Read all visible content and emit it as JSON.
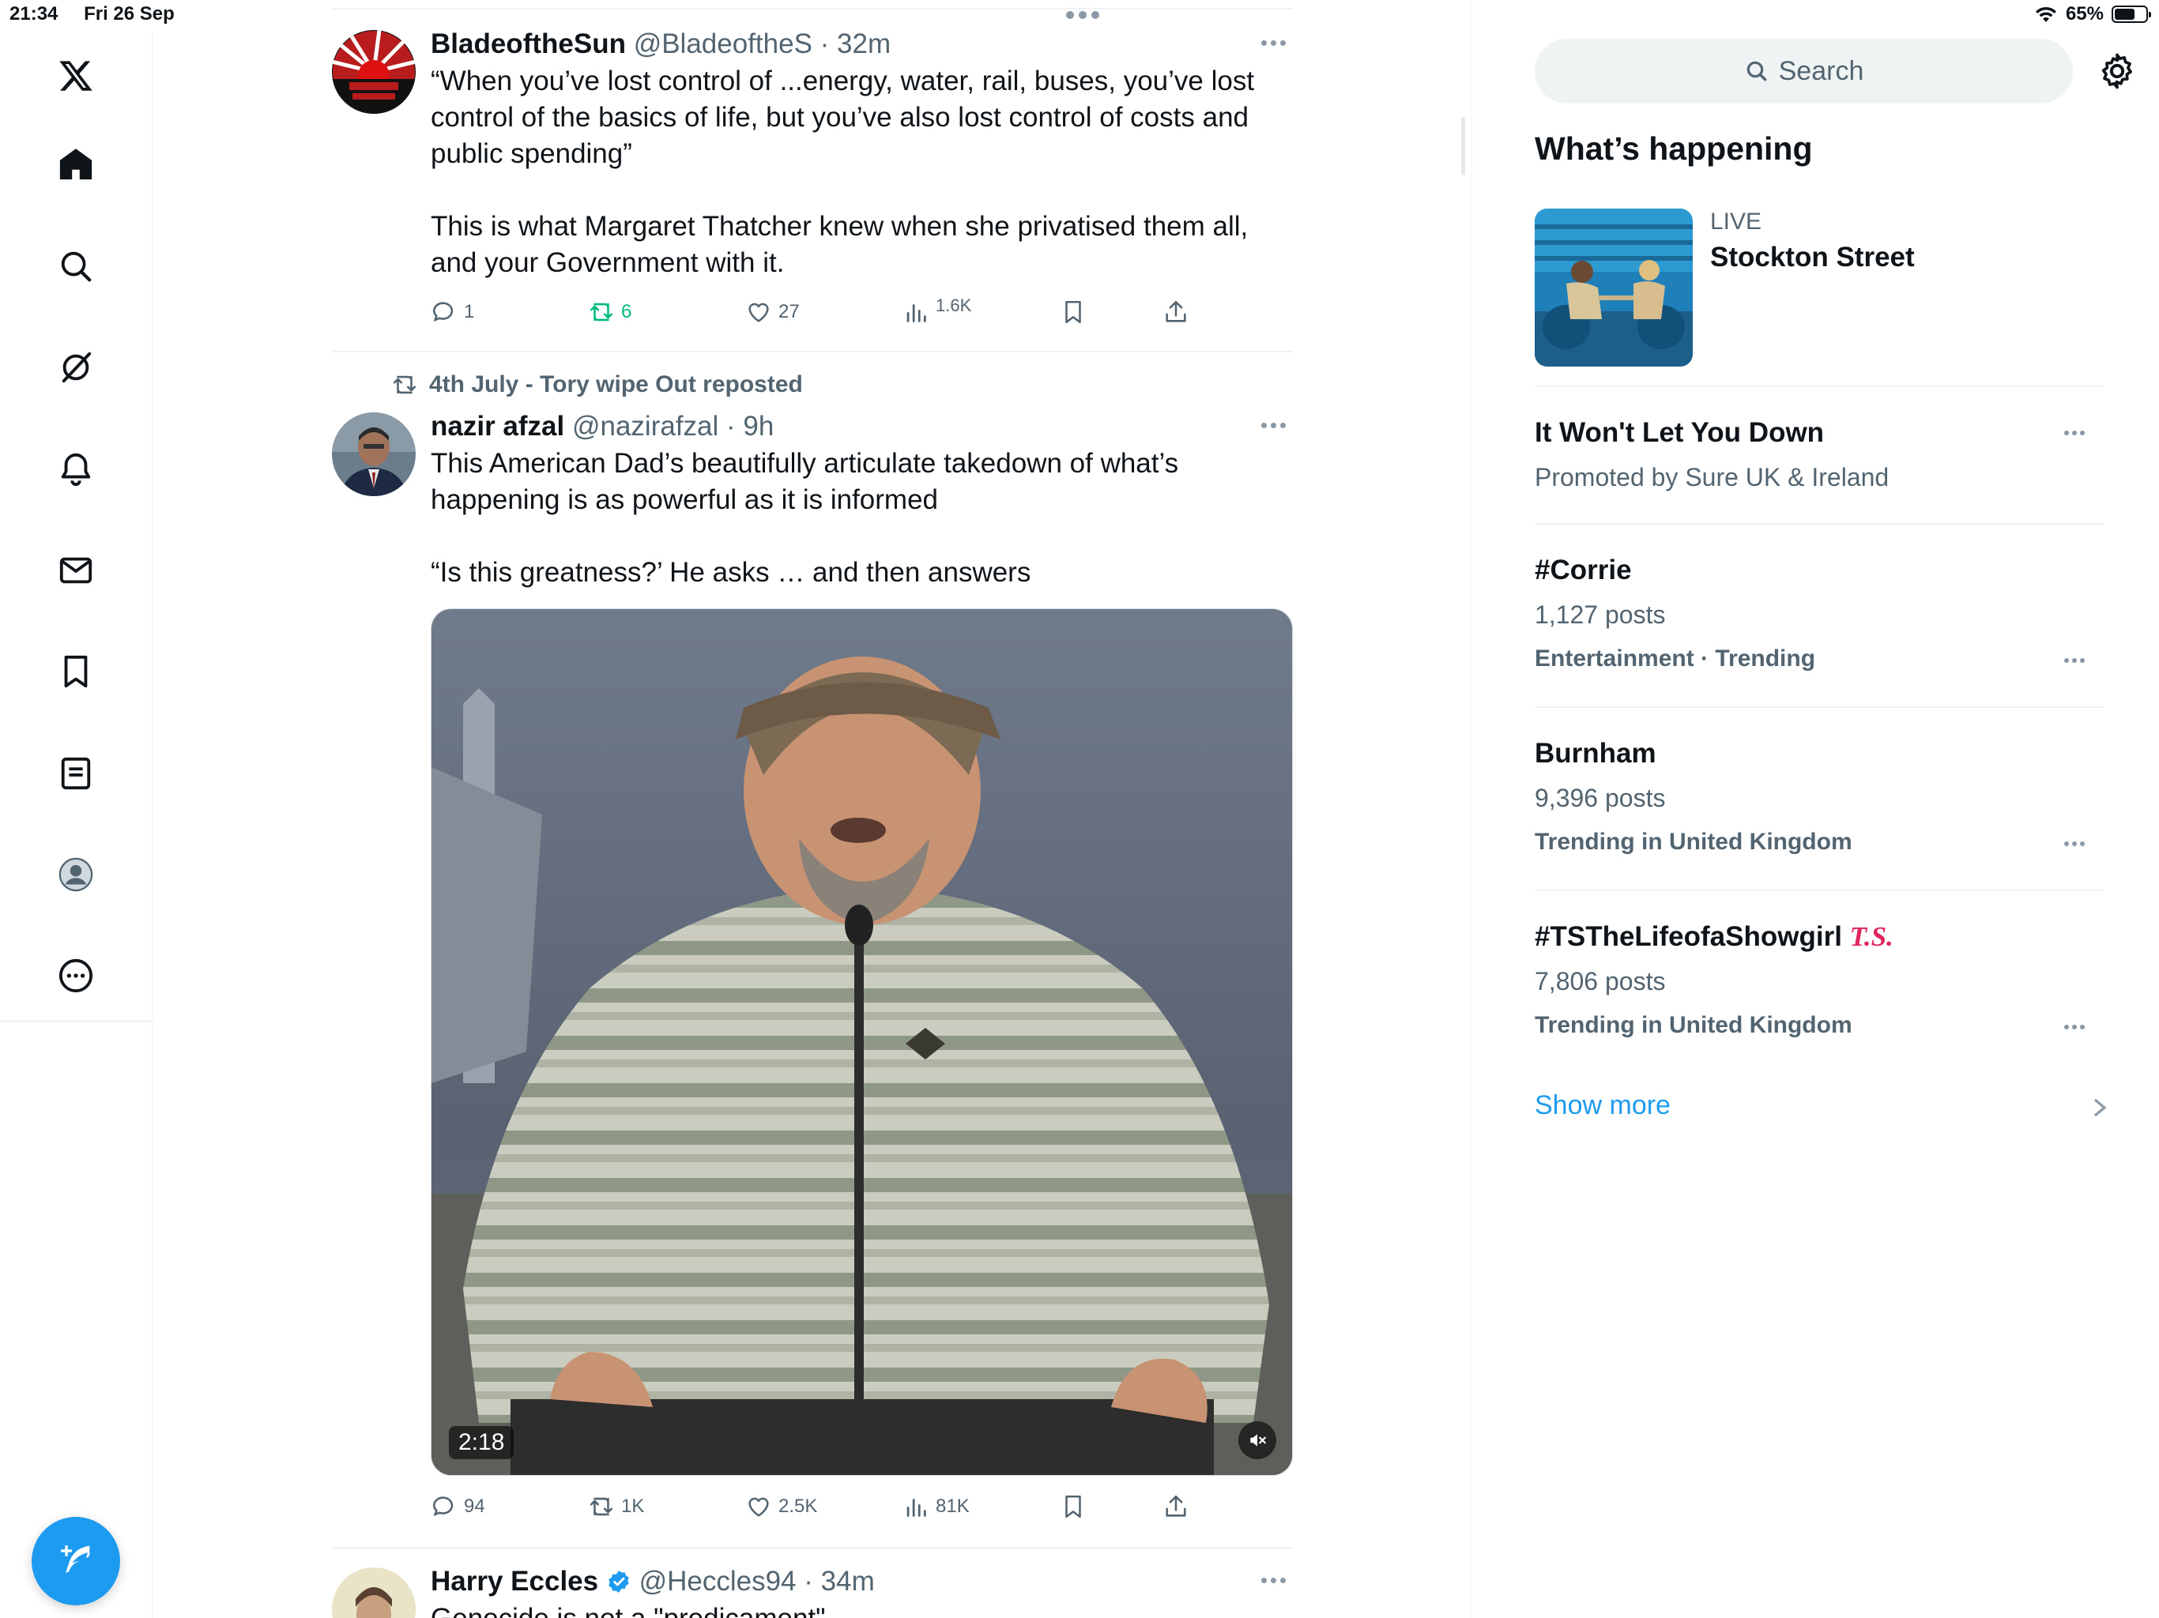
{
  "status_bar": {
    "time": "21:34",
    "date": "Fri 26 Sep",
    "battery": "65%",
    "battery_level": 0.65
  },
  "nav": {
    "items": [
      "x-logo",
      "home",
      "explore",
      "grok",
      "notifications",
      "messages",
      "bookmarks",
      "lists",
      "profile",
      "more"
    ]
  },
  "tweets": [
    {
      "name": "BladeoftheSun",
      "handle": "@BladeoftheS",
      "time": "32m",
      "text": [
        "“When you’ve lost control of ...energy, water, rail, buses, you’ve lost control of the basics of life, but you’ve also lost control of costs and public spending”",
        "This is what Margaret Thatcher knew when she privatised them all, and your Government with it."
      ],
      "replies": "1",
      "reposts": "6",
      "likes": "27",
      "views": "1.6K"
    },
    {
      "reposted_by": "4th July - Tory wipe Out reposted",
      "name": "nazir afzal",
      "handle": "@nazirafzal",
      "time": "9h",
      "text": [
        "This American Dad’s beautifully articulate takedown of what’s happening is as powerful as it is informed",
        "“Is this greatness?’ He asks … and then answers"
      ],
      "video_duration": "2:18",
      "replies": "94",
      "reposts": "1K",
      "likes": "2.5K",
      "views": "81K"
    },
    {
      "name": "Harry Eccles",
      "handle": "@Heccles94",
      "time": "34m",
      "text": [
        "Genocide is not a \"predicament\""
      ]
    }
  ],
  "sidebar": {
    "search_placeholder": "Search",
    "title": "What’s happening",
    "live": {
      "label": "LIVE",
      "title": "Stockton Street"
    },
    "trends": [
      {
        "name": "It Won't Let You Down",
        "sub": "Promoted by Sure UK & Ireland"
      },
      {
        "name": "#Corrie",
        "sub": "1,127 posts",
        "meta": "Entertainment · Trending"
      },
      {
        "name": "Burnham",
        "sub": "9,396 posts",
        "meta": "Trending in United Kingdom"
      },
      {
        "name": "#TSTheLifeofaShowgirl",
        "emoji": "T.S.",
        "sub": "7,806 posts",
        "meta": "Trending in United Kingdom"
      }
    ],
    "show_more": "Show more"
  },
  "colors": {
    "accent": "#1d9bf0",
    "repost_green": "#00ba7c",
    "muted": "#536471"
  }
}
